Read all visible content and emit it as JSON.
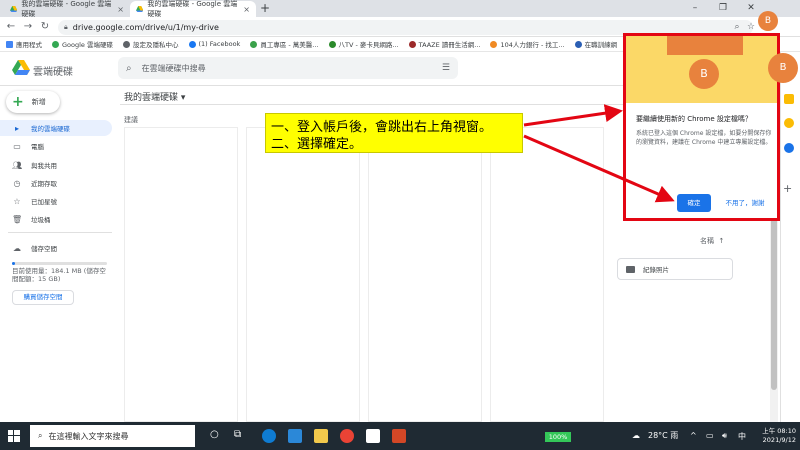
{
  "browser": {
    "tabs": [
      {
        "title": "我的雲端硬碟 - Google 雲端硬碟",
        "active": false
      },
      {
        "title": "我的雲端硬碟 - Google 雲端硬碟",
        "active": true
      }
    ],
    "url": "drive.google.com/drive/u/1/my-drive",
    "bookmarks": [
      "應用程式",
      "Google 雲端硬碟",
      "設定及隱私中心",
      "(1) Facebook",
      "員工專區 - 萬美醫...",
      "八TV - 麥卡貝網路...",
      "TAAZE 讀冊生活網...",
      "104人力銀行 - 找工...",
      "在職訓練網"
    ]
  },
  "drive": {
    "app_name": "雲端硬碟",
    "search_placeholder": "在雲端硬碟中搜尋",
    "new_label": "新增",
    "nav": [
      {
        "label": "我的雲端硬碟",
        "active": true
      },
      {
        "label": "電腦",
        "active": false
      },
      {
        "label": "與我共用",
        "active": false
      },
      {
        "label": "近期存取",
        "active": false
      },
      {
        "label": "已加星號",
        "active": false
      },
      {
        "label": "垃圾桶",
        "active": false
      }
    ],
    "storage_label": "儲存空間",
    "storage_used": "目前使用量：184.1 MB (儲存空間配額：15 GB)",
    "buy_storage": "購買儲存空間",
    "page_title": "我的雲端硬碟",
    "suggested_label": "建議",
    "sort_label": "名稱",
    "folder_name": "紀錄照片"
  },
  "popup": {
    "avatar_letter": "B",
    "title": "要繼續使用新的 Chrome 設定檔嗎？",
    "body": "系統已登入這個 Chrome 設定檔，如要分開保存你的瀏覽資料，建議在 Chrome 中建立專屬設定檔。",
    "confirm_label": "確定",
    "decline_label": "不用了，謝謝"
  },
  "profile_avatar_letter": "B",
  "annotation": {
    "line1": "一、登入帳戶後，會跳出右上角視窗。",
    "line2": "二、選擇確定。"
  },
  "taskbar": {
    "search_placeholder": "在這裡輸入文字來搜尋",
    "battery": "100%",
    "weather": "28°C 雨",
    "time": "上午 08:10",
    "date": "2021/9/12"
  },
  "colors": {
    "highlight_frame": "#e30613",
    "annotation_bg": "#ffff00",
    "accent_orange": "#e8823d",
    "primary_blue": "#1a73e8"
  }
}
